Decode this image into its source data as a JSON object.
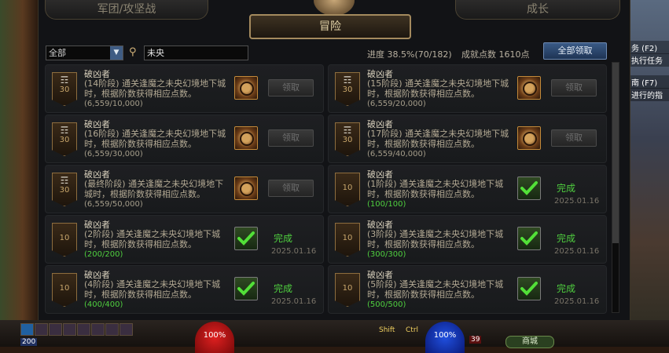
{
  "tabs": {
    "left": "军团/攻坚战",
    "center": "冒险",
    "right": "成长"
  },
  "filter": {
    "selected": "全部"
  },
  "search": {
    "value": "未央"
  },
  "summary": {
    "progress": "进度 38.5%(70/182)",
    "points": "成就点数 1610点",
    "claim_all": "全部领取"
  },
  "cards": [
    {
      "title": "破凶者",
      "desc": "(14阶段) 通关逢魔之未央幻境地下城时，根据阶数获得相应点数。",
      "progress": "(6,559/10,000)",
      "badge": "30",
      "trophy": true,
      "state": "claim",
      "button": "领取"
    },
    {
      "title": "破凶者",
      "desc": "(15阶段) 通关逢魔之未央幻境地下城时，根据阶数获得相应点数。",
      "progress": "(6,559/20,000)",
      "badge": "30",
      "trophy": true,
      "state": "claim",
      "button": "领取"
    },
    {
      "title": "破凶者",
      "desc": "(16阶段) 通关逢魔之未央幻境地下城时，根据阶数获得相应点数。",
      "progress": "(6,559/30,000)",
      "badge": "30",
      "trophy": true,
      "state": "claim",
      "button": "领取"
    },
    {
      "title": "破凶者",
      "desc": "(17阶段) 通关逢魔之未央幻境地下城时，根据阶数获得相应点数。",
      "progress": "(6,559/40,000)",
      "badge": "30",
      "trophy": true,
      "state": "claim",
      "button": "领取"
    },
    {
      "title": "破凶者",
      "desc": "(最终阶段) 通关逢魔之未央幻境地下城时，根据阶数获得相应点数。",
      "progress": "(6,559/50,000)",
      "badge": "30",
      "trophy": true,
      "state": "claim",
      "button": "领取"
    },
    {
      "title": "破凶者",
      "desc": "(1阶段) 通关逢魔之未央幻境地下城时，根据阶数获得相应点数。",
      "progress": "(100/100)",
      "badge": "10",
      "trophy": false,
      "state": "done",
      "done": "完成",
      "date": "2025.01.16"
    },
    {
      "title": "破凶者",
      "desc": "(2阶段) 通关逢魔之未央幻境地下城时，根据阶数获得相应点数。",
      "progress": "(200/200)",
      "badge": "10",
      "trophy": false,
      "state": "done",
      "done": "完成",
      "date": "2025.01.16"
    },
    {
      "title": "破凶者",
      "desc": "(3阶段) 通关逢魔之未央幻境地下城时，根据阶数获得相应点数。",
      "progress": "(300/300)",
      "badge": "10",
      "trophy": false,
      "state": "done",
      "done": "完成",
      "date": "2025.01.16"
    },
    {
      "title": "破凶者",
      "desc": "(4阶段) 通关逢魔之未央幻境地下城时，根据阶数获得相应点数。",
      "progress": "(400/400)",
      "badge": "10",
      "trophy": false,
      "state": "done",
      "done": "完成",
      "date": "2025.01.16"
    },
    {
      "title": "破凶者",
      "desc": "(5阶段) 通关逢魔之未央幻境地下城时，根据阶数获得相应点数。",
      "progress": "(500/500)",
      "badge": "10",
      "trophy": false,
      "state": "done",
      "done": "完成",
      "date": "2025.01.16"
    }
  ],
  "side_notes": [
    "务 (F2)",
    "执行任务",
    "南 (F7)",
    "进行的指"
  ],
  "hud": {
    "hp": "100%",
    "mp": "100%",
    "level_left": "200",
    "level_right": "39",
    "shop": "商城",
    "shift": "Shift",
    "ctrl": "Ctrl"
  }
}
